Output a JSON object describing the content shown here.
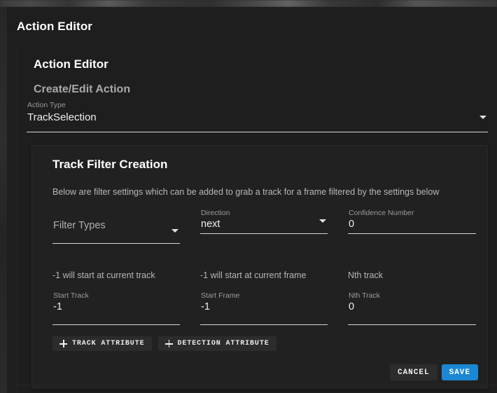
{
  "dialog": {
    "title": "Action Editor"
  },
  "panel": {
    "title": "Action Editor",
    "subtitle": "Create/Edit Action"
  },
  "action_type": {
    "label": "Action Type",
    "value": "TrackSelection",
    "caret_icon": "chevron-down-icon"
  },
  "card": {
    "heading": "Track Filter Creation",
    "description": "Below are filter settings which can be added to grab a track for a frame filtered by the settings below",
    "fields_row1": [
      {
        "name": "filter-types",
        "label": "",
        "value": "Filter Types",
        "is_placeholder": true,
        "has_caret": true
      },
      {
        "name": "direction",
        "label": "Direction",
        "value": "next",
        "is_placeholder": false,
        "has_caret": true
      },
      {
        "name": "confidence-number",
        "label": "Confidence Number",
        "value": "0",
        "is_placeholder": false,
        "has_caret": false
      }
    ],
    "hints": [
      "-1 will start at current track",
      "-1 will start at current frame",
      "Nth track"
    ],
    "fields_row2": [
      {
        "name": "start-track",
        "label": "Start Track",
        "value": "-1"
      },
      {
        "name": "start-frame",
        "label": "Start Frame",
        "value": "-1"
      },
      {
        "name": "nth-track",
        "label": "Nth Track",
        "value": "0"
      }
    ],
    "attribute_buttons": [
      {
        "name": "track-attribute",
        "label": "TRACK ATTRIBUTE",
        "icon": "plus-icon"
      },
      {
        "name": "detection-attribute",
        "label": "DETECTION ATTRIBUTE",
        "icon": "plus-icon"
      }
    ],
    "footer": {
      "cancel_label": "CANCEL",
      "save_label": "SAVE"
    }
  },
  "colors": {
    "accent_blue": "#1b88d4",
    "dialog_bg": "#1e1e1e",
    "card_bg": "#212121",
    "button_bg": "#2c2c2c",
    "text_primary": "#ffffff",
    "text_secondary": "#b6b6b6",
    "underline": "#d5d5d5"
  }
}
